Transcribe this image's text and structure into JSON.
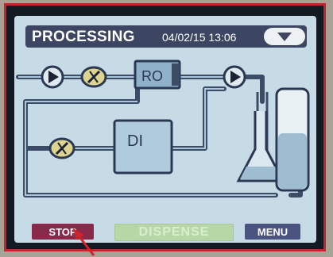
{
  "header": {
    "title": "PROCESSING",
    "datetime": "04/02/15 13:06"
  },
  "diagram": {
    "ro_label": "RO",
    "di_label": "DI"
  },
  "buttons": {
    "stop": "STOP",
    "dispense": "DISPENSE",
    "menu": "MENU"
  },
  "colors": {
    "screen_bg": "#c6dbe6",
    "header_bg": "#3c4663",
    "pipe": "#3d4c66",
    "stop_bg": "#8a2a4a",
    "dispense_bg": "#b8d7a6",
    "menu_bg": "#4b5480",
    "frame_highlight": "#c4242b"
  },
  "icons": [
    "pump-icon",
    "valve-icon",
    "ro-module-icon",
    "di-module-icon",
    "flask-icon",
    "tank-icon",
    "chevron-down-icon",
    "pointer-arrow-icon"
  ]
}
